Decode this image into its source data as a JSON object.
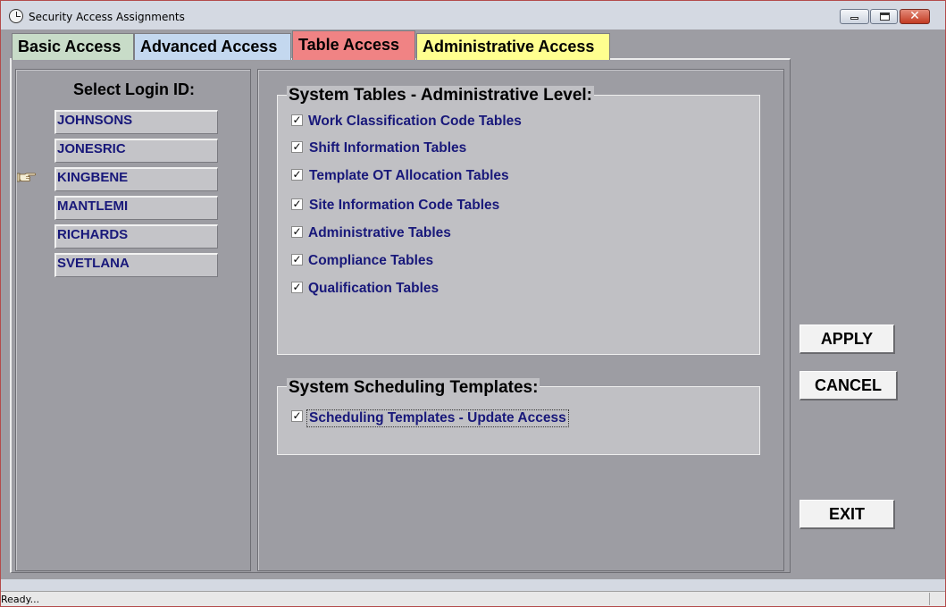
{
  "window": {
    "title": "Security Access Assignments",
    "close_glyph": "✕"
  },
  "tabs": [
    {
      "label": "Basic Access",
      "color": "#c8dcc8"
    },
    {
      "label": "Advanced Access",
      "color": "#c4d8ef"
    },
    {
      "label": "Table Access",
      "color": "#f08384",
      "selected": true
    },
    {
      "label": "Administrative Access",
      "color": "#ffff8f"
    }
  ],
  "login": {
    "heading": "Select Login ID:",
    "items": [
      "JOHNSONS",
      "JONESRIC",
      "KINGBENE",
      "MANTLEMI",
      "RICHARDS",
      "SVETLANA"
    ],
    "selected": "KINGBENE",
    "selected_marker_icon": "pointing-hand-icon"
  },
  "system_tables": {
    "title": "System Tables - Administrative Level:",
    "items": [
      {
        "label": "Work Classification Code Tables",
        "checked": true
      },
      {
        "label": "Shift Information Tables",
        "checked": true
      },
      {
        "label": "Template OT Allocation Tables",
        "checked": true
      },
      {
        "label": "Site Information Code Tables",
        "checked": true
      },
      {
        "label": "Administrative Tables",
        "checked": true
      },
      {
        "label": "Compliance Tables",
        "checked": true
      },
      {
        "label": "Qualification Tables",
        "checked": true
      }
    ]
  },
  "scheduling": {
    "title": "System Scheduling Templates:",
    "items": [
      {
        "label": "Scheduling Templates - Update Access",
        "checked": true,
        "focused": true
      }
    ]
  },
  "check_glyph": "✓",
  "buttons": {
    "apply": "APPLY",
    "cancel": "CANCEL",
    "exit": "EXIT"
  },
  "status": {
    "text": "Ready..."
  }
}
